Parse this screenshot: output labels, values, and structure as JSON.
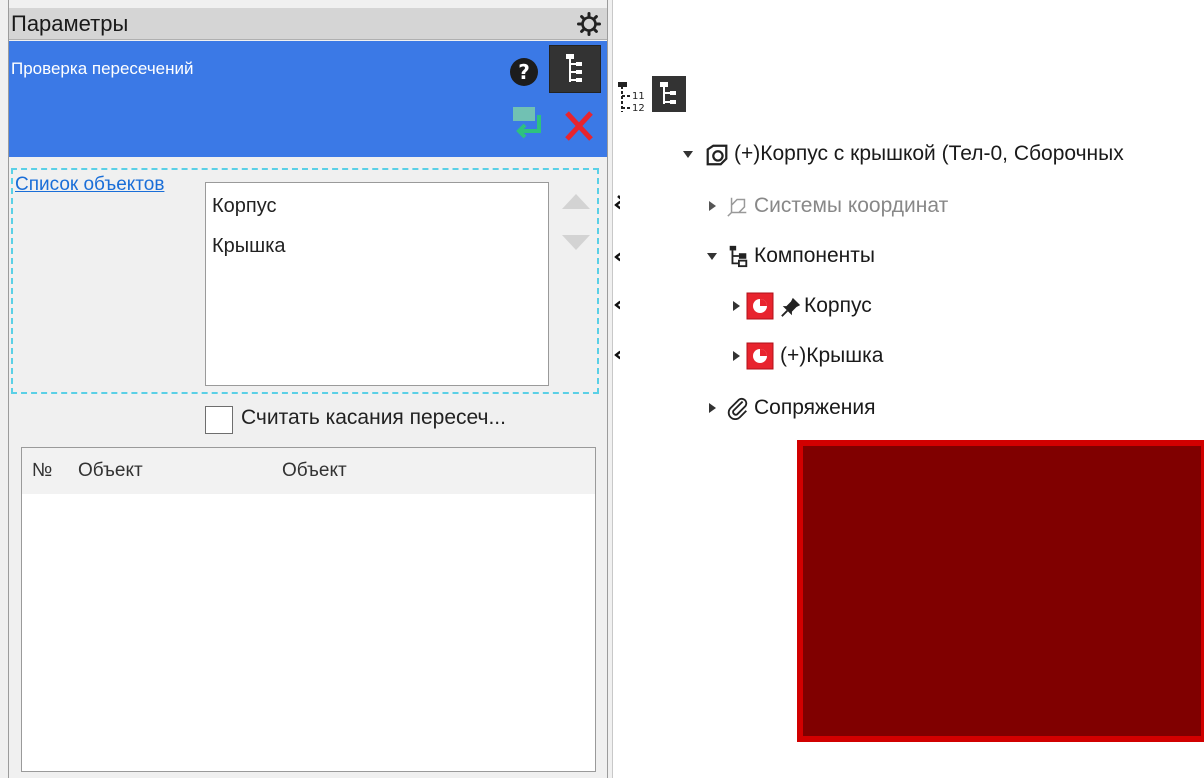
{
  "panel": {
    "title": "Параметры",
    "command": "Проверка пересечений",
    "list_link": "Список объектов",
    "list_items": [
      "Корпус",
      "Крышка"
    ],
    "checkbox_label": "Считать касания пересеч...",
    "table_headers": [
      "№",
      "Объект",
      "Объект"
    ]
  },
  "tree": {
    "root": "(+)Корпус с крышкой (Тел-0, Сборочных",
    "items": [
      {
        "label": "Системы координат"
      },
      {
        "label": "Компоненты"
      },
      {
        "label": "Корпус"
      },
      {
        "label": "(+)Крышка"
      },
      {
        "label": "Сопряжения"
      }
    ]
  },
  "colors": {
    "header_blue": "#3b79e6",
    "cancel_red": "#e8242e",
    "apply_green": "#2ec27e",
    "model_fill": "#800000",
    "model_border": "#d10000"
  }
}
